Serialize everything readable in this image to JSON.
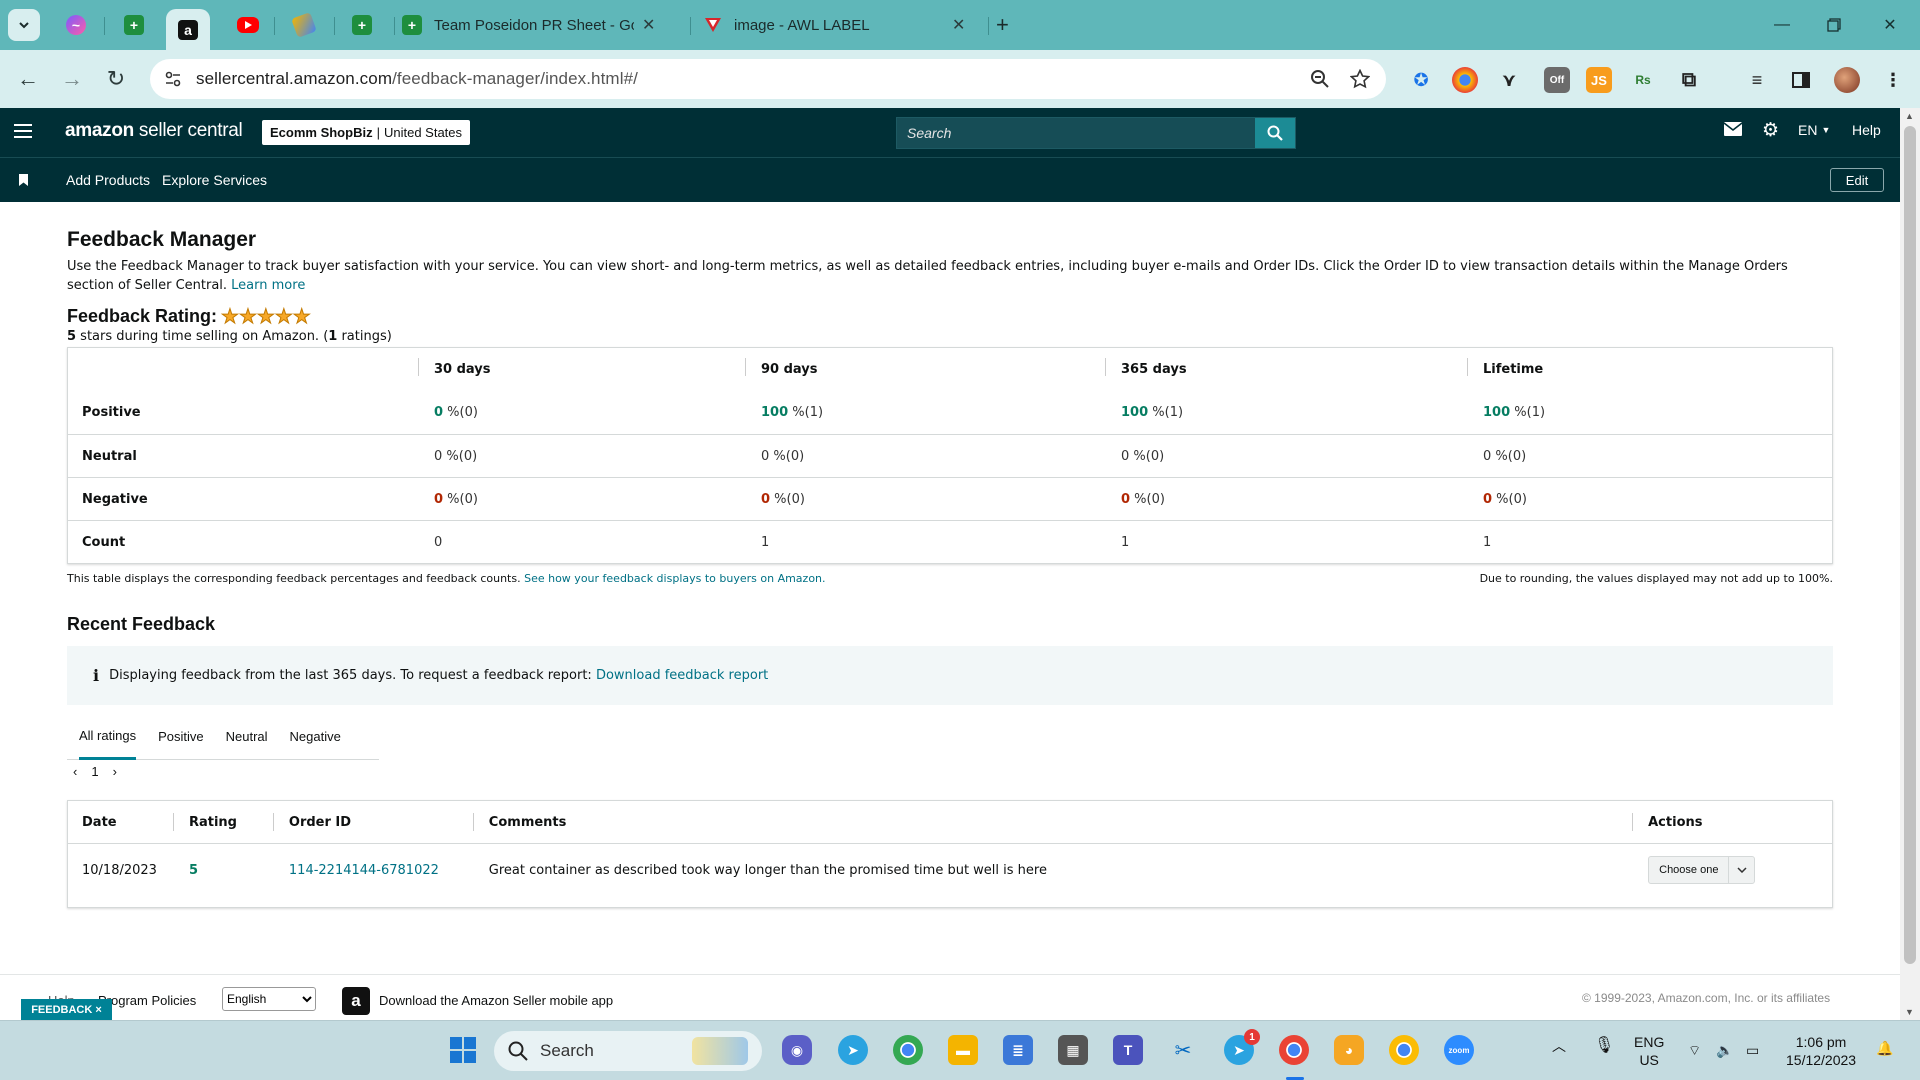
{
  "browser": {
    "tabs": [
      {
        "title": "Team Poseidon PR Sheet - Goo"
      },
      {
        "title": "image - AWL LABEL"
      }
    ],
    "url_host": "sellercentral.amazon.com",
    "url_path": "/feedback-manager/index.html#/",
    "new_tab": "+"
  },
  "sc": {
    "logo_amazon": "amazon",
    "logo_rest": " seller central",
    "store_name": "Ecomm ShopBiz",
    "store_sep": "|",
    "store_region": "United States",
    "search_placeholder": "Search",
    "lang": "EN",
    "help": "Help",
    "nav": [
      "Add Products",
      "Explore Services"
    ],
    "edit": "Edit"
  },
  "page": {
    "title": "Feedback Manager",
    "description": "Use the Feedback Manager to track buyer satisfaction with your service. You can view short- and long-term metrics, as well as detailed feedback entries, including buyer e-mails and Order IDs. Click the Order ID to view transaction details within the Manage Orders section of Seller Central.",
    "learn_more": "Learn more",
    "rating_label": "Feedback Rating:",
    "rating_stars": 5,
    "rating_sub_value": "5",
    "rating_sub_text": " stars during time selling on Amazon. (",
    "rating_sub_count": "1",
    "rating_sub_end": " ratings)"
  },
  "feedback_table": {
    "columns": [
      "30 days",
      "90 days",
      "365 days",
      "Lifetime"
    ],
    "rows": [
      {
        "label": "Positive",
        "cells": [
          [
            "0",
            " %(0)"
          ],
          [
            "100",
            " %(1)"
          ],
          [
            "100",
            " %(1)"
          ],
          [
            "100",
            " %(1)"
          ]
        ]
      },
      {
        "label": "Neutral",
        "cells": [
          [
            "0",
            " %(0)"
          ],
          [
            "0",
            " %(0)"
          ],
          [
            "0",
            " %(0)"
          ],
          [
            "0",
            " %(0)"
          ]
        ]
      },
      {
        "label": "Negative",
        "cells": [
          [
            "0",
            " %(0)"
          ],
          [
            "0",
            " %(0)"
          ],
          [
            "0",
            " %(0)"
          ],
          [
            "0",
            " %(0)"
          ]
        ]
      },
      {
        "label": "Count",
        "cells": [
          [
            "0",
            ""
          ],
          [
            "1",
            ""
          ],
          [
            "1",
            ""
          ],
          [
            "1",
            ""
          ]
        ]
      }
    ],
    "note_text": "This table displays the corresponding feedback percentages and feedback counts. ",
    "note_link": "See how your feedback displays to buyers on Amazon.",
    "rounding_note": "Due to rounding, the values displayed may not add up to 100%."
  },
  "recent": {
    "title": "Recent Feedback",
    "info_icon": "i",
    "info_text": "Displaying feedback from the last 365 days. To request a feedback report: ",
    "info_link": "Download feedback report",
    "tabs": [
      "All ratings",
      "Positive",
      "Neutral",
      "Negative"
    ],
    "page": "1",
    "columns": [
      "Date",
      "Rating",
      "Order ID",
      "Comments",
      "Actions"
    ],
    "rows": [
      {
        "date": "10/18/2023",
        "rating": "5",
        "order_id": "114-2214144-6781022",
        "comment": "Great container as described took way longer than the promised time but well is here",
        "action": "Choose one"
      }
    ]
  },
  "footer": {
    "program_policies": "Program Policies",
    "help_partial": "Help",
    "language": "English",
    "app_text": "Download the Amazon Seller mobile app",
    "copyright": "© 1999-2023, Amazon.com, Inc. or its affiliates",
    "feedback_badge": "FEEDBACK ×"
  },
  "taskbar": {
    "search_placeholder": "Search",
    "lang_top": "ENG",
    "lang_bottom": "US",
    "time": "1:06 pm",
    "date": "15/12/2023",
    "telegram_badge": "1"
  },
  "colors": {
    "tab_bg": "#5fb7b9",
    "sc_header": "#002f36",
    "positive": "#067d62",
    "negative": "#b12704",
    "link": "#007185"
  }
}
